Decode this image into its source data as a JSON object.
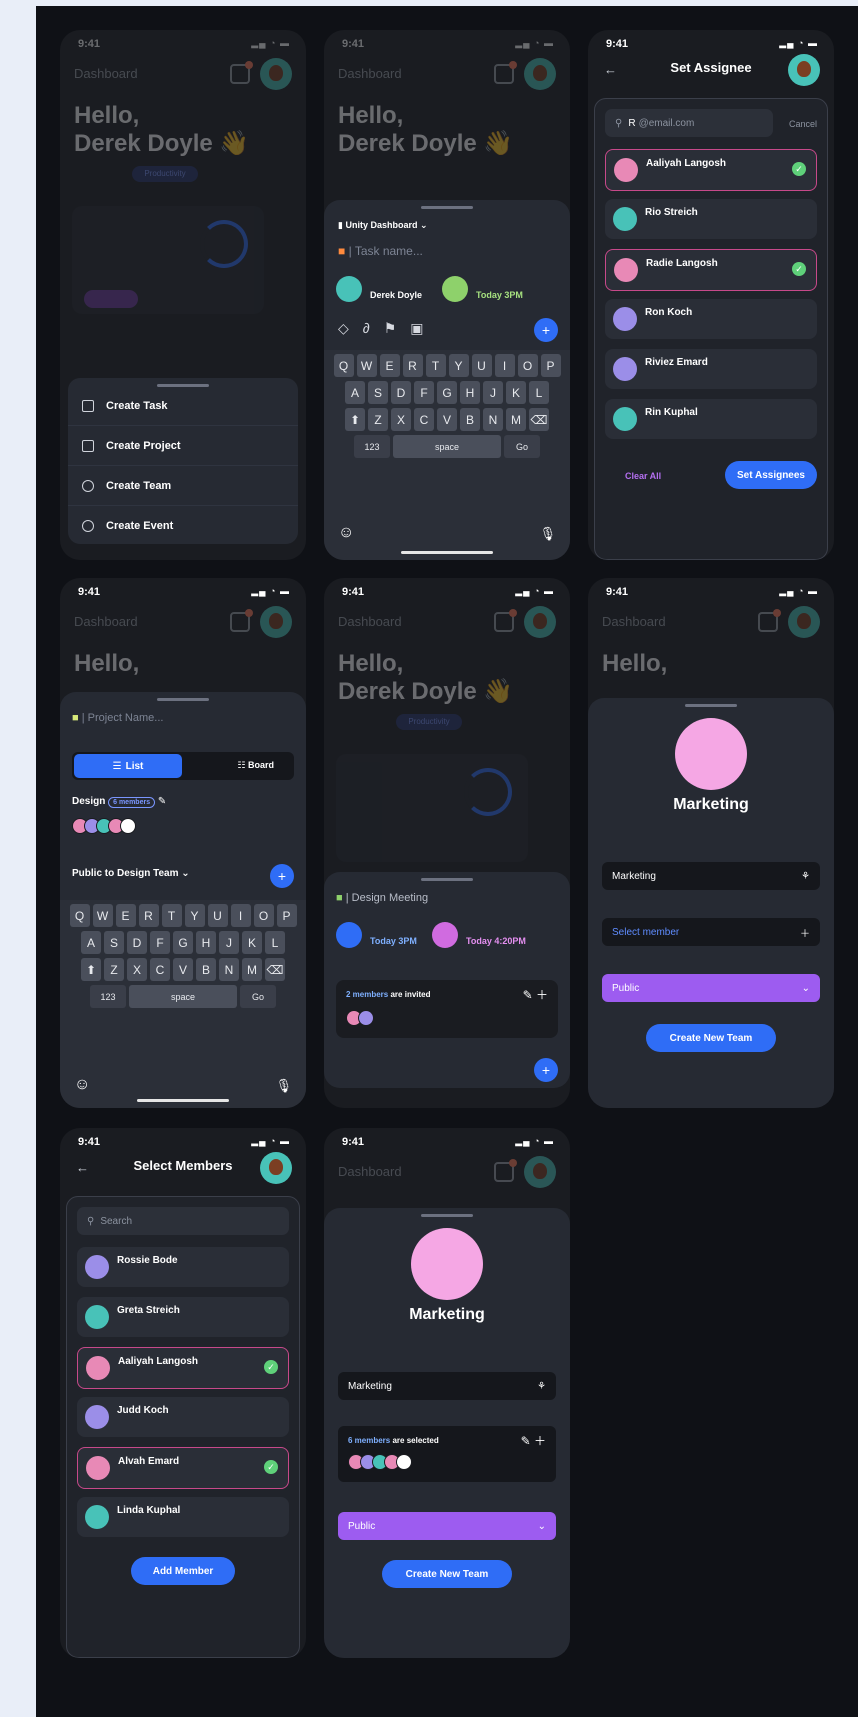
{
  "status": {
    "time": "9:41",
    "icons": "▂▄ ◔ ▬"
  },
  "dashboard": {
    "title": "Dashboard",
    "hello_line1": "Hello,",
    "hello_line2": "Derek Doyle 👋",
    "tab_productivity": "Productivity"
  },
  "create_menu": {
    "items": [
      "Create Task",
      "Create Project",
      "Create Team",
      "Create Event"
    ]
  },
  "task_sheet": {
    "project": "Unity Dashboard",
    "task_placeholder": "Task name...",
    "assigned_name": "Derek Doyle",
    "due": "Today 3PM"
  },
  "keyboard": {
    "row1": [
      "Q",
      "W",
      "E",
      "R",
      "T",
      "Y",
      "U",
      "I",
      "O",
      "P"
    ],
    "row2": [
      "A",
      "S",
      "D",
      "F",
      "G",
      "H",
      "J",
      "K",
      "L"
    ],
    "row3": [
      "Z",
      "X",
      "C",
      "V",
      "B",
      "N",
      "M"
    ],
    "num": "123",
    "space": "space",
    "go": "Go",
    "shift": "⬆",
    "del": "⌫",
    "emoji": "☺",
    "mic": "🎙"
  },
  "set_assignee": {
    "title": "Set Assignee",
    "search_value": "R",
    "search_hint": "@email.com",
    "cancel": "Cancel",
    "people": [
      {
        "name": "Aaliyah Langosh",
        "selected": true
      },
      {
        "name": "Rio Streich",
        "selected": false
      },
      {
        "name": "Radie Langosh",
        "selected": true
      },
      {
        "name": "Ron Koch",
        "selected": false
      },
      {
        "name": "Riviez Emard",
        "selected": false
      },
      {
        "name": "Rin Kuphal",
        "selected": false
      }
    ],
    "clear_all": "Clear All",
    "set_button": "Set Assignees"
  },
  "project_sheet": {
    "name_placeholder": "Project Name...",
    "list": "List",
    "board": "Board",
    "team": "Design",
    "members_badge": "6 members",
    "visibility": "Public to Design Team"
  },
  "meeting_sheet": {
    "title": "Design Meeting",
    "start": "Today 3PM",
    "end": "Today 4:20PM",
    "invited_count": "2 members",
    "invited_suffix": "are invited"
  },
  "team_sheet": {
    "team_name": "Marketing",
    "field_value": "Marketing",
    "select_member": "Select member",
    "privacy": "Public",
    "create_button": "Create New Team",
    "selected_count": "6 members",
    "selected_suffix": "are selected"
  },
  "select_members": {
    "title": "Select Members",
    "search": "Search",
    "people": [
      {
        "name": "Rossie Bode",
        "selected": false
      },
      {
        "name": "Greta Streich",
        "selected": false
      },
      {
        "name": "Aaliyah Langosh",
        "selected": true
      },
      {
        "name": "Judd Koch",
        "selected": false
      },
      {
        "name": "Alvah Emard",
        "selected": true
      },
      {
        "name": "Linda Kuphal",
        "selected": false
      }
    ],
    "add_button": "Add Member"
  }
}
